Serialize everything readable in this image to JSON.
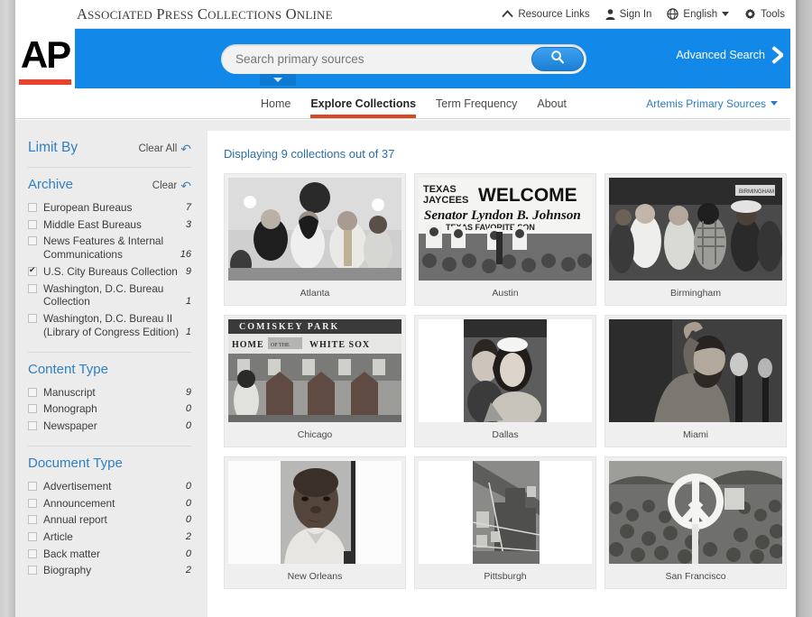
{
  "topbar": {
    "brand_small": "A",
    "brand_title_parts": [
      "A",
      "SSOCIATED ",
      "P",
      "RESS ",
      "C",
      "OLLECTIONS ",
      "O",
      "NLINE"
    ],
    "brand_title": "Associated Press Collections Online",
    "utilities": [
      {
        "id": "resource-links",
        "label": "Resource Links",
        "icon": "chevron-up-icon"
      },
      {
        "id": "sign-in",
        "label": "Sign In",
        "icon": "user-icon"
      },
      {
        "id": "english",
        "label": "English",
        "icon": "globe-icon",
        "has_caret": true
      },
      {
        "id": "tools",
        "label": "Tools",
        "icon": "gear-icon"
      }
    ]
  },
  "logo": {
    "text": "AP"
  },
  "search": {
    "placeholder": "Search primary sources",
    "value": "",
    "button_icon": "search-icon",
    "dropdown_icon": "chevron-down-icon",
    "advanced_label": "Advanced Search",
    "advanced_icon": "chevron-right-icon"
  },
  "nav": {
    "items": [
      {
        "id": "home",
        "label": "Home",
        "active": false
      },
      {
        "id": "explore-collections",
        "label": "Explore Collections",
        "active": true
      },
      {
        "id": "term-frequency",
        "label": "Term Frequency",
        "active": false
      },
      {
        "id": "about",
        "label": "About",
        "active": false
      }
    ],
    "right": {
      "label": "Artemis Primary Sources",
      "icon": "chevron-down-icon"
    }
  },
  "sidebar": {
    "title": "Limit By",
    "clear_all": "Clear All",
    "groups": [
      {
        "id": "archive",
        "title": "Archive",
        "clear": "Clear",
        "options": [
          {
            "label": "European Bureaus",
            "count": "7",
            "checked": false
          },
          {
            "label": "Middle East Bureaus",
            "count": "3",
            "checked": false
          },
          {
            "label": "News Features & Internal Communications",
            "count": "16",
            "checked": false
          },
          {
            "label": "U.S. City Bureaus Collection",
            "count": "9",
            "checked": true
          },
          {
            "label": "Washington, D.C. Bureau Collection",
            "count": "1",
            "checked": false
          },
          {
            "label": "Washington, D.C. Bureau II (Library of Congress Edition)",
            "count": "1",
            "checked": false
          }
        ]
      },
      {
        "id": "content-type",
        "title": "Content Type",
        "clear": "",
        "options": [
          {
            "label": "Manuscript",
            "count": "9",
            "checked": false
          },
          {
            "label": "Monograph",
            "count": "0",
            "checked": false
          },
          {
            "label": "Newspaper",
            "count": "0",
            "checked": false
          }
        ]
      },
      {
        "id": "document-type",
        "title": "Document Type",
        "clear": "",
        "options": [
          {
            "label": "Advertisement",
            "count": "0",
            "checked": false
          },
          {
            "label": "Announcement",
            "count": "0",
            "checked": false
          },
          {
            "label": "Annual report",
            "count": "0",
            "checked": false
          },
          {
            "label": "Article",
            "count": "2",
            "checked": false
          },
          {
            "label": "Back matter",
            "count": "0",
            "checked": false
          },
          {
            "label": "Biography",
            "count": "2",
            "checked": false
          }
        ]
      }
    ]
  },
  "results": {
    "count_text": "Displaying 9 collections out of 37",
    "collections": [
      {
        "id": "atlanta",
        "label": "Atlanta",
        "thumb": "group-of-people-photo"
      },
      {
        "id": "austin",
        "label": "Austin",
        "thumb": "welcome-banner-photo"
      },
      {
        "id": "birmingham",
        "label": "Birmingham",
        "thumb": "crowd-street-photo"
      },
      {
        "id": "chicago",
        "label": "Chicago",
        "thumb": "comiskey-park-photo"
      },
      {
        "id": "dallas",
        "label": "Dallas",
        "thumb": "woman-portrait-photo"
      },
      {
        "id": "miami",
        "label": "Miami",
        "thumb": "speaker-microphone-photo"
      },
      {
        "id": "new-orleans",
        "label": "New Orleans",
        "thumb": "man-portrait-photo"
      },
      {
        "id": "pittsburgh",
        "label": "Pittsburgh",
        "thumb": "aerial-city-photo"
      },
      {
        "id": "san-francisco",
        "label": "San Francisco",
        "thumb": "peace-sign-crowd-photo"
      }
    ]
  },
  "colors": {
    "brand_blue": "#1288e8",
    "accent_orange": "#d9491f",
    "link_blue": "#2b7cc4",
    "logo_red": "#e8412f",
    "sidebar_bg": "#ececec"
  }
}
